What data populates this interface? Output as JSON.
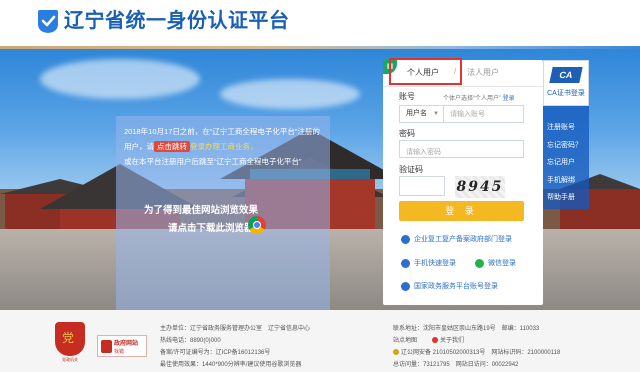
{
  "header": {
    "title": "辽宁省统一身份认证平台"
  },
  "hero": {
    "notice_parts": [
      "2018年10月17日之前，在“辽宁工商全程电子化平台”注册的用户，请",
      "点击跳转",
      "登录办理工商业务，",
      "或在本平台注册用户后跳至“辽宁工商全程电子化平台”"
    ],
    "line1": "为了得到最佳网站浏览效果",
    "line2": "请点击下载此浏览器"
  },
  "login": {
    "tab_personal": "个人用户",
    "tab_separator": "/",
    "tab_corporate": "法人用户",
    "qr_label": "▦",
    "account_label": "账号",
    "account_hint_prefix": "个体户选择“个人用户”",
    "account_hint_link": "登录",
    "account_type": "用户名",
    "account_placeholder": "请输入账号",
    "password_label": "密码",
    "password_placeholder": "请输入密码",
    "captcha_label": "验证码",
    "captcha_text": "8945",
    "login_button": "登 录",
    "options": {
      "enterprise": "企业复工复产备案政府部门登录",
      "mobile": "手机快速登录",
      "wechat": "微信登录",
      "national": "国家政务服务平台账号登录"
    }
  },
  "sidebar": {
    "ca_logo": "CA",
    "ca_label": "CA证书登录",
    "items": [
      "注册账号",
      "忘记密码？",
      "忘记用户",
      "手机解绑",
      "帮助手册"
    ]
  },
  "footer": {
    "emblem_caption": "党政机关",
    "gov_badge_title": "政府网站",
    "gov_badge_sub": "找错",
    "host": "主办单位：辽宁省政务服务管理办公室　辽宁省信息中心",
    "hotline": "热线电话：8890(0)000",
    "icp": "备案/许可证编号为：辽ICP备16012136号",
    "browser": "最佳使用效果：1440*900分辨率/建议使用谷歌浏览器",
    "address": "联系地址：沈阳市皇姑区崇山东路19号　邮编：110033",
    "sitemap": "站点地图",
    "contact": "关于我们",
    "police": "辽公网安备 21010502000313号　网站标识码：2100000118",
    "visits": "总访问量：73121795　网站日访问：00022942"
  },
  "colors": {
    "brand_blue": "#1a5fb4",
    "login_button": "#f4b823",
    "highlight_red": "#e5322e",
    "sidebar_blue": "#145abe"
  }
}
